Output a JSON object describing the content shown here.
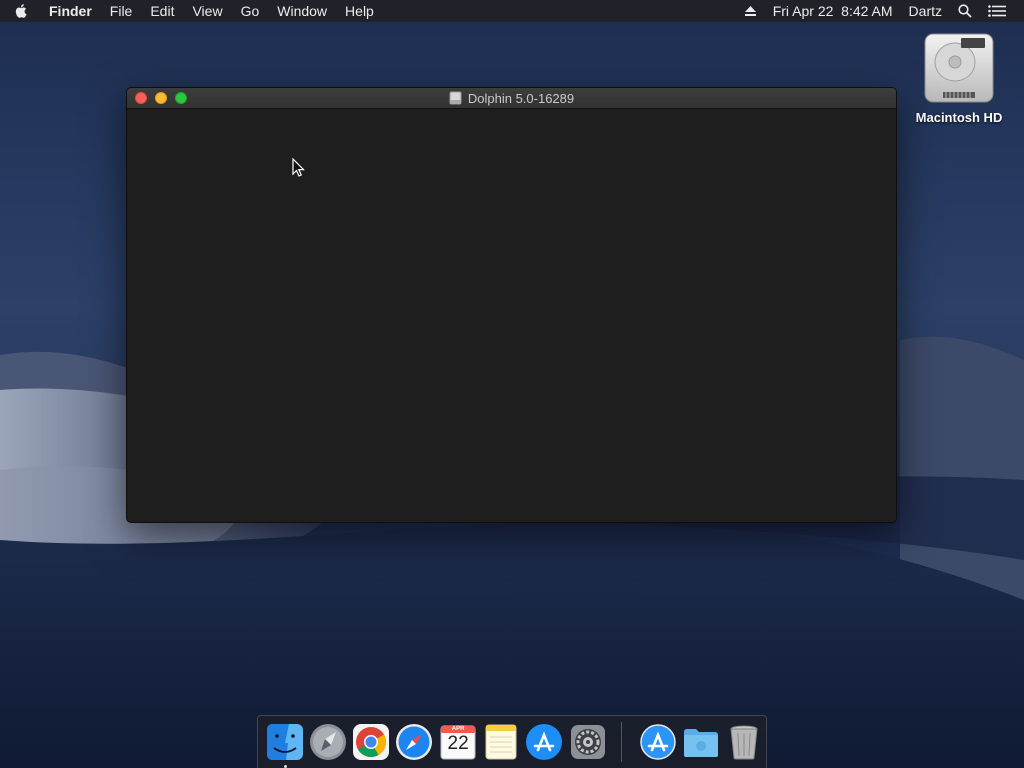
{
  "menubar": {
    "app_name": "Finder",
    "menus": [
      "File",
      "Edit",
      "View",
      "Go",
      "Window",
      "Help"
    ],
    "status": {
      "datetime": "Fri Apr 22  8:42 AM",
      "user": "Dartz"
    }
  },
  "desktop": {
    "icons": [
      {
        "label": "Macintosh HD",
        "icon": "hard-drive-icon"
      }
    ]
  },
  "window": {
    "title": "Dolphin 5.0-16289"
  },
  "dock": {
    "items": [
      {
        "name": "Finder",
        "icon": "finder-icon",
        "running": true
      },
      {
        "name": "Launchpad",
        "icon": "launchpad-icon",
        "running": false
      },
      {
        "name": "Google Chrome",
        "icon": "chrome-icon",
        "running": false
      },
      {
        "name": "Safari",
        "icon": "safari-icon",
        "running": false
      },
      {
        "name": "Calendar",
        "icon": "calendar-icon",
        "running": false,
        "month": "APR",
        "day": "22"
      },
      {
        "name": "Notes",
        "icon": "notes-icon",
        "running": false
      },
      {
        "name": "App Store",
        "icon": "app-store-icon",
        "running": false
      },
      {
        "name": "System Preferences",
        "icon": "system-preferences-icon",
        "running": false
      },
      {
        "name": "Applications",
        "icon": "app-store-folder-icon",
        "running": false
      },
      {
        "name": "Downloads",
        "icon": "downloads-folder-icon",
        "running": false
      },
      {
        "name": "Trash",
        "icon": "trash-icon",
        "running": false
      }
    ]
  },
  "colors": {
    "close": "#fc5f57",
    "minimize": "#fdbc2e",
    "maximize": "#29c840",
    "window_bg": "#1e1e1e"
  }
}
